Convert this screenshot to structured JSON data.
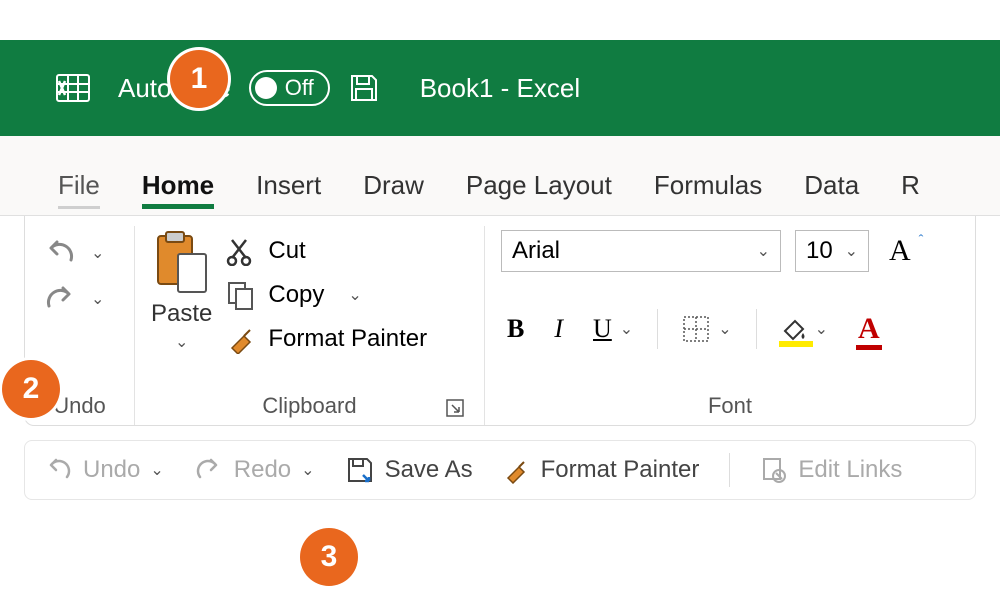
{
  "titlebar": {
    "autosave_label": "AutoSave",
    "autosave_state": "Off",
    "doc_title": "Book1  -  Excel"
  },
  "tabs": [
    "File",
    "Home",
    "Insert",
    "Draw",
    "Page Layout",
    "Formulas",
    "Data",
    "R"
  ],
  "active_tab_index": 1,
  "ribbon": {
    "undo": {
      "group_label": "Undo"
    },
    "clipboard": {
      "paste_label": "Paste",
      "cut_label": "Cut",
      "copy_label": "Copy",
      "format_painter_label": "Format Painter",
      "group_label": "Clipboard"
    },
    "font": {
      "font_name": "Arial",
      "font_size": "10",
      "bold": "B",
      "italic": "I",
      "underline": "U",
      "group_label": "Font"
    }
  },
  "qat": {
    "undo": "Undo",
    "redo": "Redo",
    "save_as": "Save As",
    "format_painter": "Format Painter",
    "edit_links": "Edit Links"
  },
  "callouts": {
    "one": "1",
    "two": "2",
    "three": "3"
  }
}
